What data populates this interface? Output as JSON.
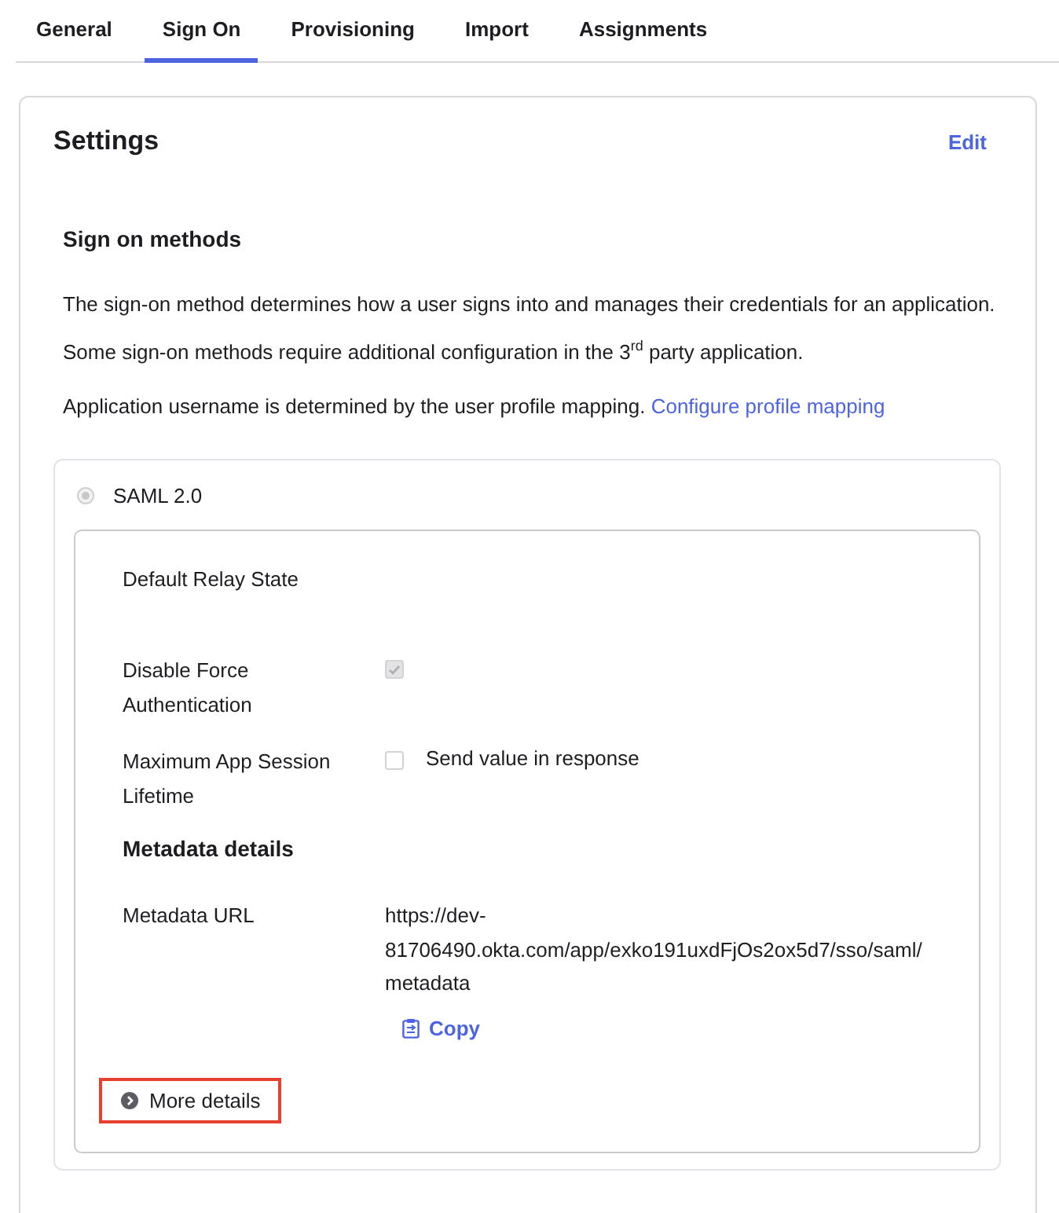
{
  "tabs": [
    {
      "label": "General",
      "selected": false
    },
    {
      "label": "Sign On",
      "selected": true
    },
    {
      "label": "Provisioning",
      "selected": false
    },
    {
      "label": "Import",
      "selected": false
    },
    {
      "label": "Assignments",
      "selected": false
    }
  ],
  "settings": {
    "title": "Settings",
    "edit_link": "Edit",
    "section_title": "Sign on methods",
    "description": "The sign-on method determines how a user signs into and manages their credentials for an application. Some sign-on methods require additional configuration in the 3$^{rd}$ party application.",
    "username_note": "Application username is determined by the user profile mapping.",
    "username_link": "Configure profile mapping",
    "method": {
      "label": "SAML 2.0",
      "selected": true,
      "disabled": true
    },
    "fields": [
      {
        "kind": "text",
        "label": "Default Relay State"
      },
      {
        "kind": "checkbox",
        "label": "Disable Force Authentication",
        "checked": true,
        "disabled": true
      },
      {
        "kind": "checkbox",
        "label": "Maximum App Session Lifetime",
        "checked": false,
        "disabled": true,
        "option_label": "Send value in response"
      }
    ],
    "metadata_title": "Metadata details",
    "metadata_label": "Metadata URL",
    "metadata_url": "https://dev-81706490.okta.com/app/exko191uxdFjOs2ox5d7/sso/saml/metadata",
    "copy_button": "Copy",
    "more_details": {
      "label": "More details",
      "highlighted": true
    }
  }
}
